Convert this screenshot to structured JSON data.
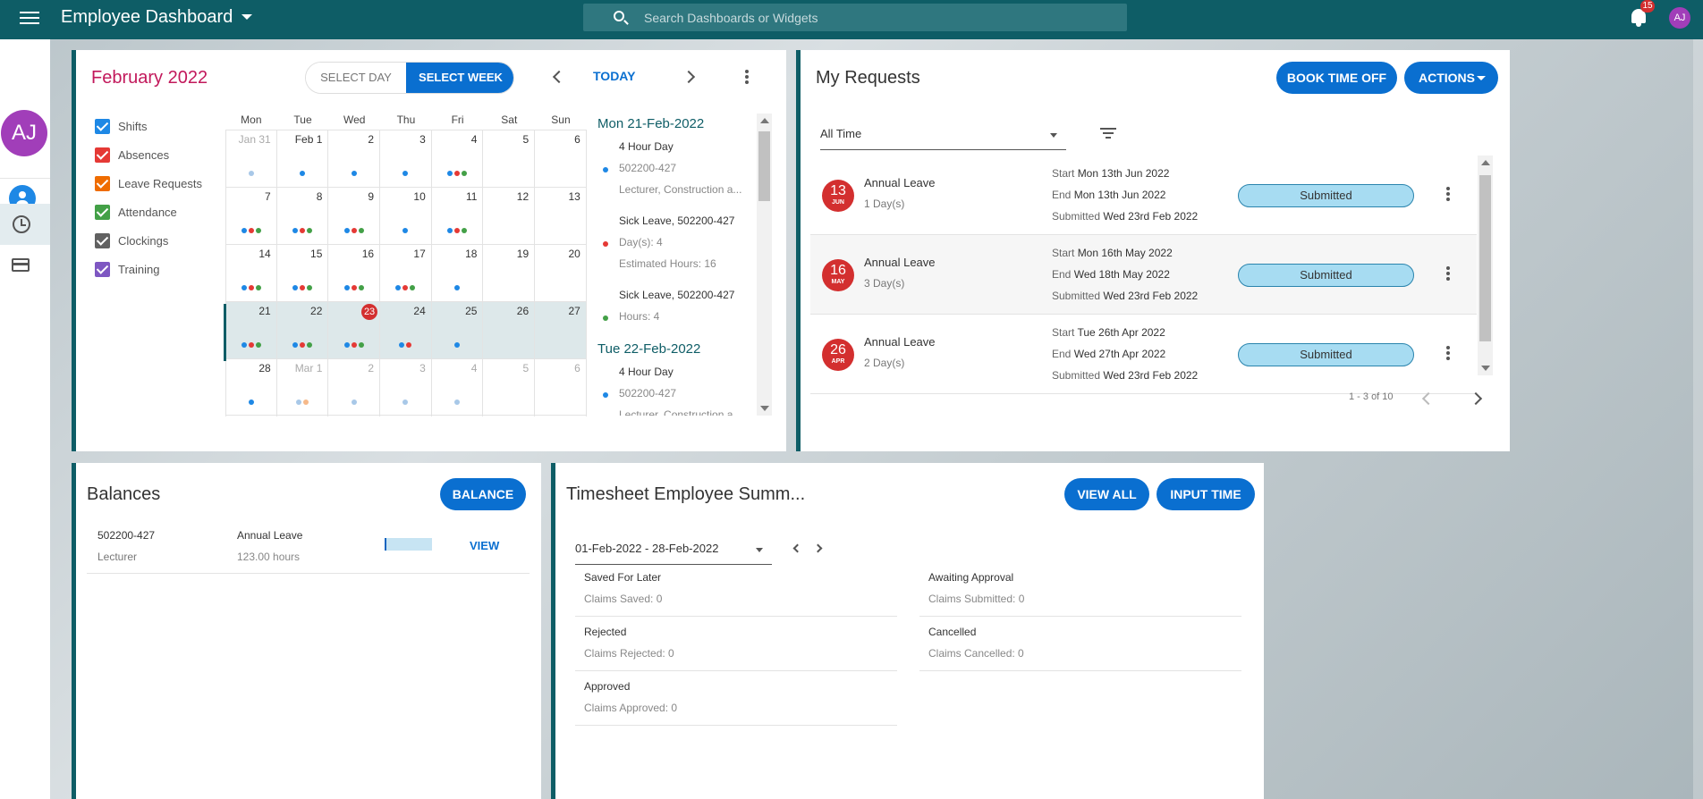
{
  "header": {
    "title": "Employee Dashboard",
    "search_placeholder": "Search Dashboards or Widgets",
    "notifications_count": "15",
    "user_initials": "AJ"
  },
  "sidebar": {
    "avatar_initials": "AJ",
    "items": [
      {
        "icon": "person-icon",
        "active": false
      },
      {
        "icon": "clock-icon",
        "active": true
      },
      {
        "icon": "credit-card-icon",
        "active": false
      }
    ]
  },
  "calendar": {
    "title": "February 2022",
    "select_day_label": "SELECT DAY",
    "select_week_label": "SELECT WEEK",
    "today_label": "TODAY",
    "filters": [
      {
        "label": "Shifts",
        "color": "#1e88e5"
      },
      {
        "label": "Absences",
        "color": "#e53935"
      },
      {
        "label": "Leave Requests",
        "color": "#ef6c00"
      },
      {
        "label": "Attendance",
        "color": "#43a047"
      },
      {
        "label": "Clockings",
        "color": "#616161"
      },
      {
        "label": "Training",
        "color": "#7e57c2"
      }
    ],
    "weekdays": [
      "Mon",
      "Tue",
      "Wed",
      "Thu",
      "Fri",
      "Sat",
      "Sun"
    ],
    "weeks": [
      [
        {
          "d": "Jan 31",
          "m": true,
          "dots": [
            "#a8c8e8"
          ]
        },
        {
          "d": "Feb  1",
          "dots": [
            "#1e88e5"
          ]
        },
        {
          "d": "2",
          "dots": [
            "#1e88e5"
          ]
        },
        {
          "d": "3",
          "dots": [
            "#1e88e5"
          ]
        },
        {
          "d": "4",
          "dots": [
            "#1e88e5",
            "#e53935",
            "#43a047"
          ]
        },
        {
          "d": "5",
          "dots": []
        },
        {
          "d": "6",
          "dots": []
        }
      ],
      [
        {
          "d": "7",
          "dots": [
            "#1e88e5",
            "#e53935",
            "#43a047"
          ]
        },
        {
          "d": "8",
          "dots": [
            "#1e88e5",
            "#e53935",
            "#43a047"
          ]
        },
        {
          "d": "9",
          "dots": [
            "#1e88e5",
            "#e53935",
            "#43a047"
          ]
        },
        {
          "d": "10",
          "dots": [
            "#1e88e5"
          ]
        },
        {
          "d": "11",
          "dots": [
            "#1e88e5",
            "#e53935",
            "#43a047"
          ]
        },
        {
          "d": "12",
          "dots": []
        },
        {
          "d": "13",
          "dots": []
        }
      ],
      [
        {
          "d": "14",
          "dots": [
            "#1e88e5",
            "#e53935",
            "#43a047"
          ]
        },
        {
          "d": "15",
          "dots": [
            "#1e88e5",
            "#e53935",
            "#43a047"
          ]
        },
        {
          "d": "16",
          "dots": [
            "#1e88e5",
            "#e53935",
            "#43a047"
          ]
        },
        {
          "d": "17",
          "dots": [
            "#1e88e5",
            "#e53935",
            "#43a047"
          ]
        },
        {
          "d": "18",
          "dots": [
            "#1e88e5"
          ]
        },
        {
          "d": "19",
          "dots": []
        },
        {
          "d": "20",
          "dots": []
        }
      ],
      [
        {
          "d": "21",
          "dots": [
            "#1e88e5",
            "#e53935",
            "#43a047"
          ]
        },
        {
          "d": "22",
          "dots": [
            "#1e88e5",
            "#e53935",
            "#43a047"
          ]
        },
        {
          "d": "23",
          "today": true,
          "dots": [
            "#1e88e5",
            "#e53935",
            "#43a047"
          ]
        },
        {
          "d": "24",
          "dots": [
            "#1e88e5",
            "#e53935"
          ]
        },
        {
          "d": "25",
          "dots": [
            "#1e88e5"
          ]
        },
        {
          "d": "26",
          "dots": []
        },
        {
          "d": "27",
          "dots": []
        }
      ],
      [
        {
          "d": "28",
          "dots": [
            "#1e88e5"
          ]
        },
        {
          "d": "Mar  1",
          "m": true,
          "dots": [
            "#a8c8e8",
            "#f6b98a"
          ]
        },
        {
          "d": "2",
          "m": true,
          "dots": [
            "#a8c8e8"
          ]
        },
        {
          "d": "3",
          "m": true,
          "dots": [
            "#a8c8e8"
          ]
        },
        {
          "d": "4",
          "m": true,
          "dots": [
            "#a8c8e8"
          ]
        },
        {
          "d": "5",
          "m": true,
          "dots": []
        },
        {
          "d": "6",
          "m": true,
          "dots": []
        }
      ]
    ],
    "agenda": [
      {
        "date": "Mon 21-Feb-2022",
        "events": [
          {
            "line1": "4 Hour Day",
            "line2": "502200-427",
            "line3": "Lecturer, Construction a...",
            "color": "#1e88e5"
          },
          {
            "line1": "Sick Leave, 502200-427",
            "line2": "Day(s): 4",
            "line3": "Estimated Hours: 16",
            "color": "#e53935"
          },
          {
            "line1": "Sick Leave, 502200-427",
            "line2": "Hours: 4",
            "line3": "",
            "color": "#43a047"
          }
        ]
      },
      {
        "date": "Tue 22-Feb-2022",
        "events": [
          {
            "line1": "4 Hour Day",
            "line2": "502200-427",
            "line3": "Lecturer, Construction a...",
            "color": "#1e88e5"
          }
        ]
      }
    ]
  },
  "requests": {
    "title": "My Requests",
    "book_label": "BOOK TIME OFF",
    "actions_label": "ACTIONS",
    "period_value": "All Time",
    "start_label": "Start",
    "end_label": "End",
    "submitted_label": "Submitted",
    "items": [
      {
        "day": "13",
        "month": "JUN",
        "type": "Annual Leave",
        "days": "1 Day(s)",
        "start": "Mon 13th Jun 2022",
        "end": "Mon 13th Jun 2022",
        "submitted": "Wed 23rd Feb 2022",
        "status": "Submitted"
      },
      {
        "day": "16",
        "month": "MAY",
        "type": "Annual Leave",
        "days": "3 Day(s)",
        "start": "Mon 16th May 2022",
        "end": "Wed 18th May 2022",
        "submitted": "Wed 23rd Feb 2022",
        "status": "Submitted"
      },
      {
        "day": "26",
        "month": "APR",
        "type": "Annual Leave",
        "days": "2 Day(s)",
        "start": "Tue 26th Apr 2022",
        "end": "Wed 27th Apr 2022",
        "submitted": "Wed 23rd Feb 2022",
        "status": "Submitted"
      }
    ],
    "pagination": "1 - 3 of 10"
  },
  "balances": {
    "title": "Balances",
    "button_label": "BALANCE",
    "row": {
      "id": "502200-427",
      "role": "Lecturer",
      "type": "Annual Leave",
      "amount": "123.00 hours",
      "used_fraction": 0.04,
      "view_label": "VIEW"
    }
  },
  "timesheet": {
    "title": "Timesheet Employee Summ...",
    "view_all_label": "VIEW ALL",
    "input_time_label": "INPUT TIME",
    "period": "01-Feb-2022 - 28-Feb-2022",
    "items": [
      {
        "title": "Saved For Later",
        "sub": "Claims Saved: 0"
      },
      {
        "title": "Awaiting Approval",
        "sub": "Claims Submitted: 0"
      },
      {
        "title": "Rejected",
        "sub": "Claims Rejected: 0"
      },
      {
        "title": "Cancelled",
        "sub": "Claims Cancelled: 0"
      },
      {
        "title": "Approved",
        "sub": "Claims Approved: 0"
      }
    ]
  },
  "colors": {
    "brand": "#0e5d66",
    "primary_button": "#0a6fd0",
    "today": "#d32f2f",
    "avatar": "#a13eb9"
  }
}
